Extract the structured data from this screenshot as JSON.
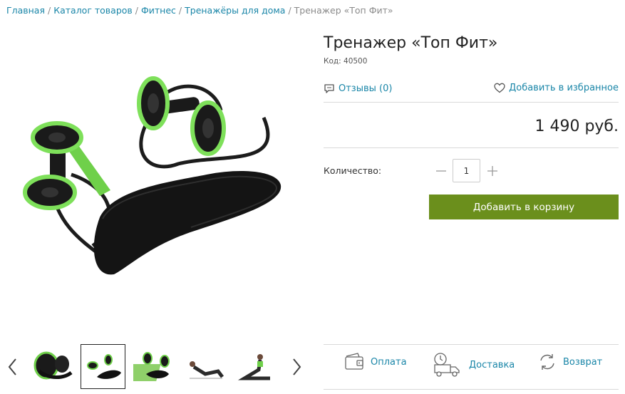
{
  "breadcrumb": {
    "items": [
      "Главная",
      "Каталог товаров",
      "Фитнес",
      "Тренажёры для дома"
    ],
    "current": "Тренажер «Топ Фит»",
    "separator": "/"
  },
  "product": {
    "title": "Тренажер «Топ Фит»",
    "code": "Код: 40500",
    "reviews": "Отзывы (0)",
    "favorite": "Добавить в избранное",
    "price": "1 490 руб.",
    "quantity_label": "Количество:",
    "quantity_value": "1",
    "add_to_cart": "Добавить в корзину"
  },
  "gallery": {
    "thumbnails": [
      "thumb-1",
      "thumb-2",
      "thumb-3",
      "thumb-4",
      "thumb-5"
    ],
    "active_index": 1
  },
  "services": {
    "payment": "Оплата",
    "delivery": "Доставка",
    "return": "Возврат"
  },
  "colors": {
    "link": "#1a86a8",
    "button": "#6b8f1c",
    "accent_green": "#6fd04a"
  }
}
